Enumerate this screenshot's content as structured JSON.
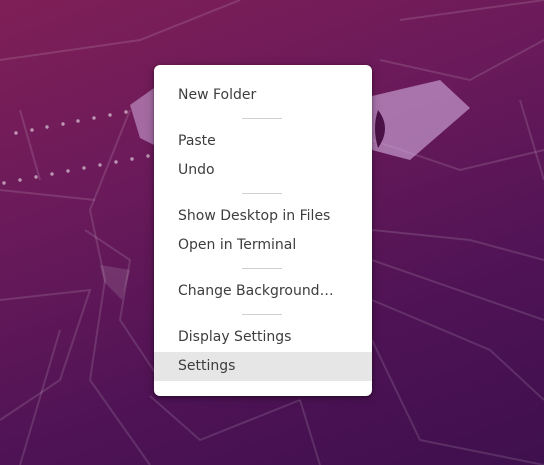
{
  "context_menu": {
    "items": [
      {
        "label": "New Folder"
      },
      {
        "label": "Paste"
      },
      {
        "label": "Undo"
      },
      {
        "label": "Show Desktop in Files"
      },
      {
        "label": "Open in Terminal"
      },
      {
        "label": "Change Background…"
      },
      {
        "label": "Display Settings"
      },
      {
        "label": "Settings",
        "hovered": true
      }
    ]
  },
  "colors": {
    "wallpaper_top": "#7f1f57",
    "wallpaper_bottom": "#3f0f4d",
    "menu_background": "#ffffff",
    "menu_text": "#3d3d3d",
    "hover_background": "#e6e6e6"
  }
}
